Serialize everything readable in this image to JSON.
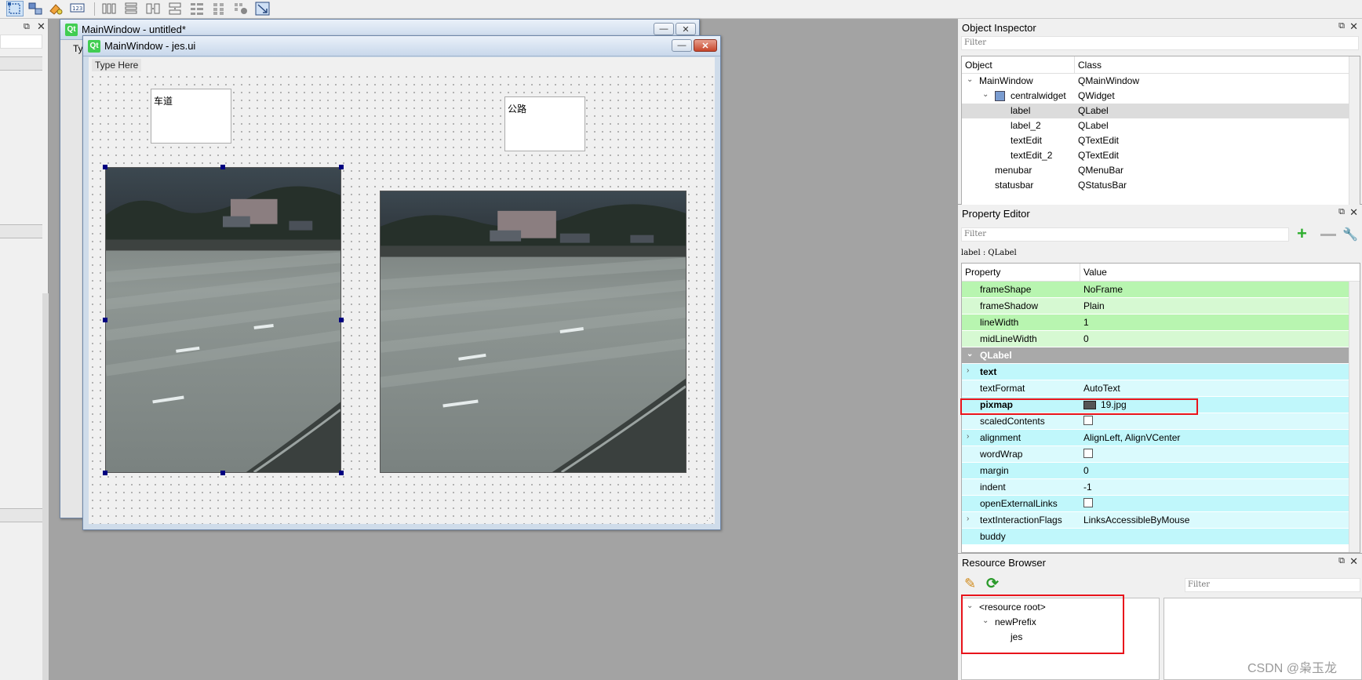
{
  "toolbar": {
    "icons": [
      "edit-widgets-icon",
      "edit-signals-icon",
      "edit-buddies-icon",
      "edit-tab-order-icon",
      "layout-horizontal-icon",
      "layout-vertical-icon",
      "layout-hsplitter-icon",
      "layout-vsplitter-icon",
      "layout-form-icon",
      "layout-grid-icon",
      "break-layout-icon",
      "adjust-size-icon"
    ]
  },
  "bg_window": {
    "title": "MainWindow - untitled*",
    "menu_fragment": "Ty"
  },
  "form_window": {
    "title": "MainWindow - jes.ui",
    "logo": "Qt",
    "menu_placeholder": "Type Here",
    "label_1_text": "车道",
    "label_2_text": "公路",
    "minimize": "—",
    "close": "✕"
  },
  "object_inspector": {
    "title": "Object Inspector",
    "filter_placeholder": "Filter",
    "col_object": "Object",
    "col_class": "Class",
    "rows": [
      {
        "object": "MainWindow",
        "class": "QMainWindow"
      },
      {
        "object": "centralwidget",
        "class": "QWidget"
      },
      {
        "object": "label",
        "class": "QLabel"
      },
      {
        "object": "label_2",
        "class": "QLabel"
      },
      {
        "object": "textEdit",
        "class": "QTextEdit"
      },
      {
        "object": "textEdit_2",
        "class": "QTextEdit"
      },
      {
        "object": "menubar",
        "class": "QMenuBar"
      },
      {
        "object": "statusbar",
        "class": "QStatusBar"
      }
    ]
  },
  "property_editor": {
    "title": "Property Editor",
    "filter_placeholder": "Filter",
    "context": "label : QLabel",
    "col_property": "Property",
    "col_value": "Value",
    "rows": [
      {
        "name": "frameShape",
        "value": "NoFrame"
      },
      {
        "name": "frameShadow",
        "value": "Plain"
      },
      {
        "name": "lineWidth",
        "value": "1"
      },
      {
        "name": "midLineWidth",
        "value": "0"
      },
      {
        "name": "QLabel",
        "value": ""
      },
      {
        "name": "text",
        "value": ""
      },
      {
        "name": "textFormat",
        "value": "AutoText"
      },
      {
        "name": "pixmap",
        "value": "19.jpg"
      },
      {
        "name": "scaledContents",
        "value": ""
      },
      {
        "name": "alignment",
        "value": "AlignLeft, AlignVCenter"
      },
      {
        "name": "wordWrap",
        "value": ""
      },
      {
        "name": "margin",
        "value": "0"
      },
      {
        "name": "indent",
        "value": "-1"
      },
      {
        "name": "openExternalLinks",
        "value": ""
      },
      {
        "name": "textInteractionFlags",
        "value": "LinksAccessibleByMouse"
      },
      {
        "name": "buddy",
        "value": ""
      }
    ]
  },
  "resource_browser": {
    "title": "Resource Browser",
    "filter_placeholder": "Filter",
    "tree": [
      "<resource root>",
      "newPrefix",
      "jes"
    ]
  },
  "watermark": "CSDN @枭玉龙",
  "colors": {
    "highlight_box": "#e8141b",
    "frame_group": "#b8f5b0",
    "label_group": "#c0f7fb",
    "selection_handle": "#000080"
  }
}
